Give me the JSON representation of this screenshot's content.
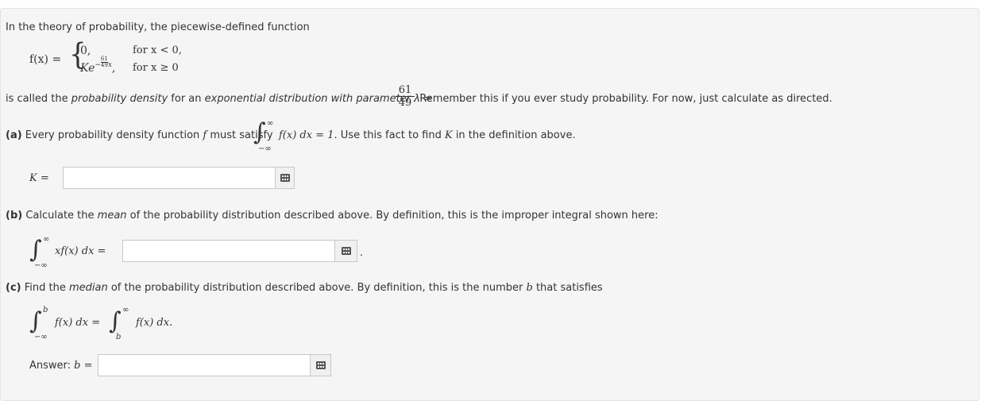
{
  "intro": "In the theory of probability, the piecewise-defined function",
  "piecewise": {
    "lhs": "f(x) =",
    "case1_value": "0,",
    "case1_cond": "for x < 0,",
    "case2_K": "Ke",
    "case2_exp_sign": "−",
    "case2_exp_num": "61",
    "case2_exp_den": "49",
    "case2_exp_var": "x",
    "case2_comma": ",",
    "case2_cond": "for x ≥ 0"
  },
  "definition": {
    "prefix": "is called the ",
    "density_term": "probability density",
    "mid": " for an ",
    "exponential_term": "exponential distribution with parameter λ",
    "equals": " =",
    "lambda_num": "61",
    "lambda_den": "49",
    "suffix": ". Remember this if you ever study probability. For now, just calculate as directed."
  },
  "part_a": {
    "label": "(a)",
    "text": " Every probability density function ",
    "f": "f",
    "text2": " must satisfy",
    "upper": "∞",
    "lower": "−∞",
    "integrand": "f(x) dx = 1",
    "text3": ". Use this fact to find ",
    "K": "K",
    "text4": " in the definition above.",
    "answer_label": "K =",
    "answer_value": ""
  },
  "part_b": {
    "label": "(b)",
    "text": " Calculate the ",
    "mean_term": "mean",
    "text2": " of the probability distribution described above. By definition, this is the improper integral shown here:",
    "upper": "∞",
    "lower": "−∞",
    "integrand": "xf(x) dx =",
    "answer_value": "",
    "trailing": "."
  },
  "part_c": {
    "label": "(c)",
    "text": " Find the ",
    "median_term": "median",
    "text2": " of the probability distribution described above. By definition, this is the number ",
    "b": "b",
    "text3": " that satisfies",
    "upper1": "b",
    "lower1": "−∞",
    "integrand1": "f(x) dx =",
    "upper2": "∞",
    "lower2": "b",
    "integrand2": "f(x) dx.",
    "answer_label": "Answer: ",
    "answer_var": "b",
    "answer_eq": " =",
    "answer_value": ""
  },
  "icons": {
    "math_input": "keypad-icon"
  }
}
